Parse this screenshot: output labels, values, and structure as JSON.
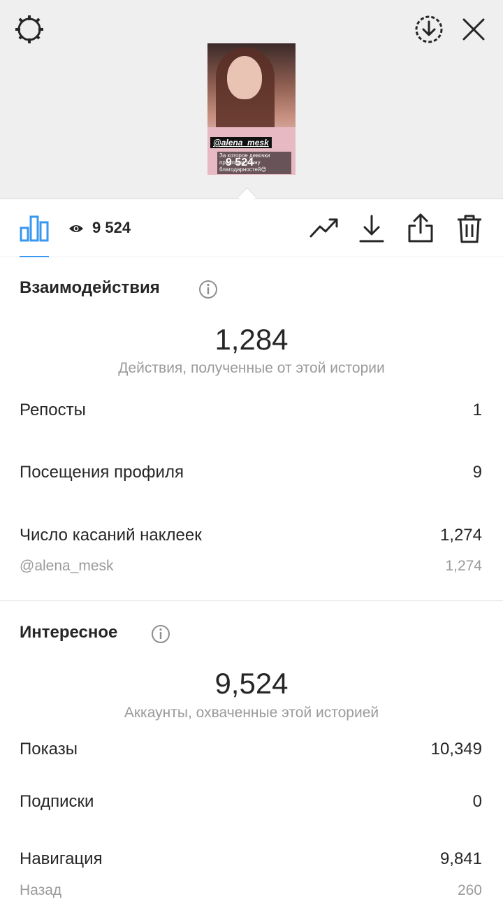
{
  "story": {
    "mention": "@alena_mesk",
    "caption": "За которое девочки прислали тонну благодарностей😍",
    "views_overlay": "9 524"
  },
  "toolbar": {
    "views": "9 524"
  },
  "interactions": {
    "title": "Взаимодействия",
    "total": "1,284",
    "total_caption": "Действия, полученные от этой истории",
    "rows": [
      {
        "label": "Репосты",
        "value": "1"
      },
      {
        "label": "Посещения профиля",
        "value": "9"
      },
      {
        "label": "Число касаний наклеек",
        "value": "1,274"
      }
    ],
    "sub_row": {
      "label": "@alena_mesk",
      "value": "1,274"
    }
  },
  "discovery": {
    "title": "Интересное",
    "total": "9,524",
    "total_caption": "Аккаунты, охваченные этой историей",
    "rows": [
      {
        "label": "Показы",
        "value": "10,349"
      },
      {
        "label": "Подписки",
        "value": "0"
      },
      {
        "label": "Навигация",
        "value": "9,841"
      }
    ],
    "sub_row": {
      "label": "Назад",
      "value": "260"
    }
  },
  "colors": {
    "accent": "#3897f0",
    "text": "#262626",
    "secondary_text": "#9a9a9a",
    "top_background": "#efefef"
  },
  "icons": {
    "settings": "settings-icon",
    "save_circle": "save-circle-icon",
    "close": "close-icon",
    "insights": "bar-chart-icon",
    "eye": "eye-icon",
    "trend": "trend-icon",
    "download": "download-icon",
    "share": "share-icon",
    "delete": "trash-icon",
    "info": "info-icon"
  }
}
